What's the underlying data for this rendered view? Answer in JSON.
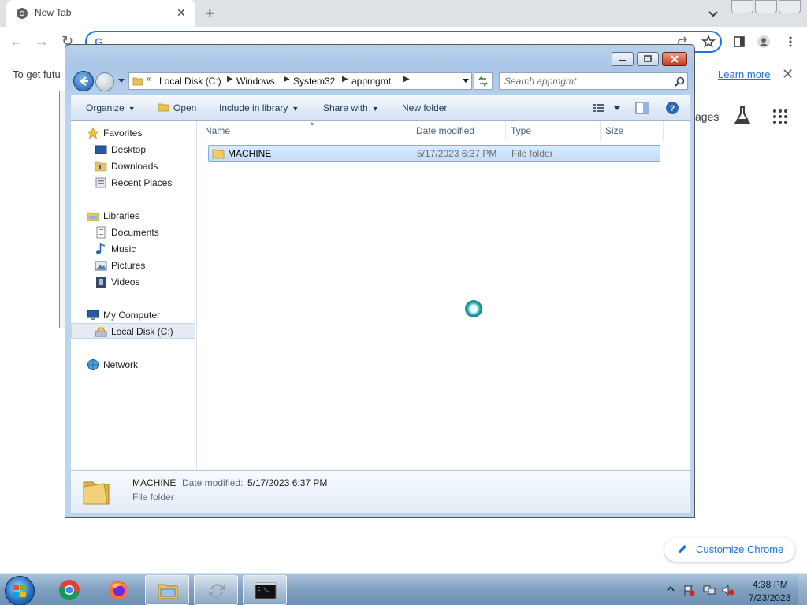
{
  "chrome": {
    "tab_title": "New Tab",
    "infobar_text": "To get futu",
    "learn_more": "Learn more",
    "ntp_images_fragment": "ages",
    "customize_label": "Customize Chrome"
  },
  "explorer": {
    "breadcrumbs": [
      "Local Disk (C:)",
      "Windows",
      "System32",
      "appmgmt"
    ],
    "search_placeholder": "Search appmgmt",
    "commands": {
      "organize": "Organize",
      "open": "Open",
      "include_in_library": "Include in library",
      "share_with": "Share with",
      "new_folder": "New folder"
    },
    "nav": {
      "favorites": "Favorites",
      "desktop": "Desktop",
      "downloads": "Downloads",
      "recent_places": "Recent Places",
      "libraries": "Libraries",
      "documents": "Documents",
      "music": "Music",
      "pictures": "Pictures",
      "videos": "Videos",
      "my_computer": "My Computer",
      "local_disk": "Local Disk (C:)",
      "network": "Network"
    },
    "columns": {
      "name": "Name",
      "date_modified": "Date modified",
      "type": "Type",
      "size": "Size"
    },
    "files": [
      {
        "name": "MACHINE",
        "date_modified": "5/17/2023 6:37 PM",
        "type": "File folder",
        "size": ""
      }
    ],
    "details": {
      "name": "MACHINE",
      "date_label": "Date modified:",
      "date_value": "5/17/2023 6:37 PM",
      "type": "File folder"
    }
  },
  "taskbar": {
    "apps": [
      "chrome-icon",
      "firefox-icon",
      "explorer-icon",
      "sync-icon",
      "cmd-icon"
    ],
    "time": "4:38 PM",
    "date": "7/23/2023"
  },
  "colors": {
    "chrome_accent": "#1a73e8",
    "explorer_frame": "#bcd5ef",
    "selection": "#c4dcf8"
  }
}
